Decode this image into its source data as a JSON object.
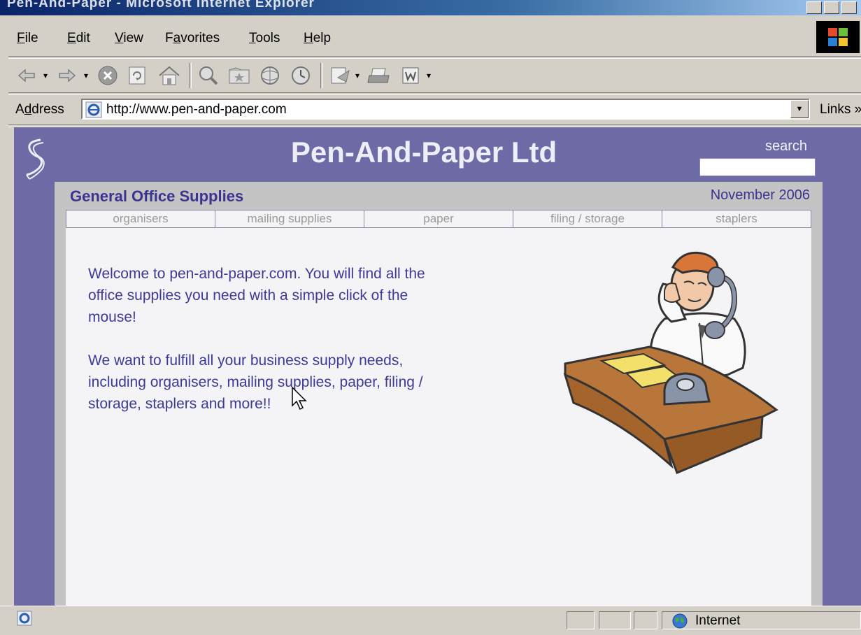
{
  "window": {
    "title": "Pen-And-Paper - Microsoft Internet Explorer"
  },
  "menubar": {
    "items": [
      {
        "key": "F",
        "rest": "ile"
      },
      {
        "key": "E",
        "rest": "dit"
      },
      {
        "key": "V",
        "rest": "iew"
      },
      {
        "pre": "F",
        "key": "a",
        "rest": "vorites"
      },
      {
        "key": "T",
        "rest": "ools"
      },
      {
        "key": "H",
        "rest": "elp"
      }
    ]
  },
  "toolbar": {
    "buttons": [
      "back-icon",
      "forward-icon",
      "stop-icon",
      "refresh-icon",
      "home-icon",
      "search-icon",
      "favorites-icon",
      "media-icon",
      "history-icon",
      "mail-icon",
      "print-icon",
      "word-edit-icon"
    ]
  },
  "address": {
    "label_pre": "A",
    "label_key": "d",
    "label_rest": "dress",
    "url": "http://www.pen-and-paper.com",
    "links_label": "Links",
    "links_chevron": "»"
  },
  "site": {
    "title": "Pen-And-Paper Ltd",
    "search_label": "search",
    "section_title": "General Office Supplies",
    "date": "November 2006",
    "nav": [
      "organisers",
      "mailing supplies",
      "paper",
      "filing / storage",
      "staplers"
    ],
    "paragraph1": "Welcome to pen-and-paper.com. You will find all the office supplies you need with a simple click of the mouse!",
    "paragraph2": "We want to fulfill all your business supply needs, including organisers, mailing supplies, paper, filing / storage, staplers and more!!"
  },
  "statusbar": {
    "zone": "Internet"
  },
  "colors": {
    "page_background": "#6d6aa6",
    "text_accent": "#3c3a96",
    "chrome": "#d4d0c8"
  }
}
